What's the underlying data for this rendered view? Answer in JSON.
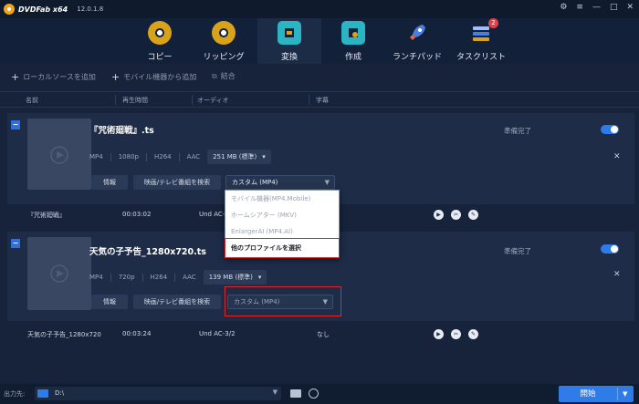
{
  "app": {
    "brand": "DVDFab x64",
    "version": "12.0.1.8"
  },
  "nav": [
    {
      "label": "コピー",
      "icon": "disc-copy-icon",
      "color": "#d9a21b"
    },
    {
      "label": "リッピング",
      "icon": "disc-rip-icon",
      "color": "#d9a21b"
    },
    {
      "label": "変換",
      "icon": "film-convert-icon",
      "color": "#2bb5c4",
      "active": true
    },
    {
      "label": "作成",
      "icon": "film-create-icon",
      "color": "#2bb5c4"
    },
    {
      "label": "ランチパッド",
      "icon": "rocket-icon",
      "color": "#4a7fe0"
    },
    {
      "label": "タスクリスト",
      "icon": "task-list-icon",
      "color": "#4a7fe0",
      "badge": "2"
    }
  ],
  "toolbar": {
    "add_local": "ローカルソースを追加",
    "add_mobile": "モバイル機器から追加",
    "merge": "結合"
  },
  "columns": {
    "name": "名前",
    "duration": "再生時間",
    "audio": "オーディオ",
    "subtitle": "字幕"
  },
  "items": [
    {
      "title": "『咒術廻戦』.ts",
      "format": "MP4",
      "resolution": "1080p",
      "codec": "H264",
      "audio": "AAC",
      "size": "251 MB (標準)",
      "info_label": "情報",
      "search_label": "映画/テレビ番組を検索",
      "profile": "カスタム (MP4)",
      "status": "準備完了",
      "row": {
        "name": "『咒術廻戦』",
        "duration": "00:03:02",
        "audio": "Und AC-3/2",
        "subtitle": ""
      }
    },
    {
      "title": "天気の子予告_1280x720.ts",
      "format": "MP4",
      "resolution": "720p",
      "codec": "H264",
      "audio": "AAC",
      "size": "139 MB (標準)",
      "info_label": "情報",
      "search_label": "映画/テレビ番組を検索",
      "profile": "カスタム (MP4)",
      "status": "準備完了",
      "row": {
        "name": "天気の子予告_1280x720",
        "duration": "00:03:24",
        "audio": "Und AC-3/2",
        "subtitle": "なし"
      }
    }
  ],
  "dropdown": {
    "options": [
      "モバイル機器(MP4.Mobile)",
      "ホームシアター (MKV)",
      "EnlargerAI (MP4.AI)",
      "他のプロファイルを選択"
    ]
  },
  "footer": {
    "output_label": "出力先:",
    "path": "D:\\",
    "start_label": "開始"
  },
  "colors": {
    "accent": "#2f7ce8",
    "highlight": "#e2262a",
    "badge": "#e0404a"
  }
}
